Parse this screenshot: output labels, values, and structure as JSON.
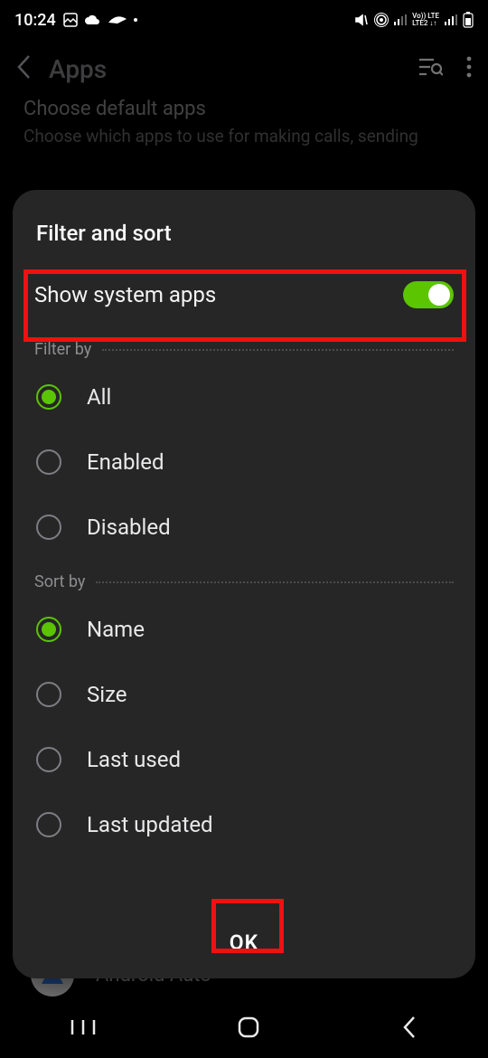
{
  "status": {
    "time": "10:24"
  },
  "header": {
    "title": "Apps"
  },
  "background": {
    "heading": "Choose default apps",
    "sub": "Choose which apps to use for making calls, sending"
  },
  "modal": {
    "title": "Filter and sort",
    "showSystem": {
      "label": "Show system apps",
      "on": true
    },
    "filter": {
      "label": "Filter by",
      "options": [
        {
          "label": "All",
          "selected": true
        },
        {
          "label": "Enabled",
          "selected": false
        },
        {
          "label": "Disabled",
          "selected": false
        }
      ]
    },
    "sort": {
      "label": "Sort by",
      "options": [
        {
          "label": "Name",
          "selected": true
        },
        {
          "label": "Size",
          "selected": false
        },
        {
          "label": "Last used",
          "selected": false
        },
        {
          "label": "Last updated",
          "selected": false
        }
      ]
    },
    "ok": "OK"
  },
  "peek": {
    "app": "Android Auto"
  }
}
